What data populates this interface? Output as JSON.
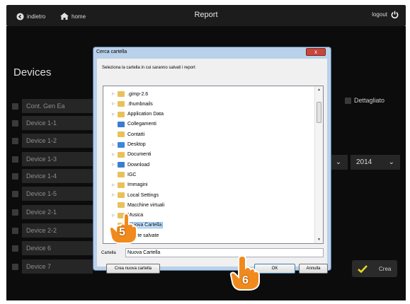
{
  "topbar": {
    "back_label": "indietro",
    "home_label": "home",
    "title": "Report",
    "logout_label": "logout"
  },
  "devices": {
    "title": "Devices",
    "items": [
      {
        "label": "Cont. Gen Ea"
      },
      {
        "label": "Device 1-1"
      },
      {
        "label": "Device 1-2"
      },
      {
        "label": "Device 1-3"
      },
      {
        "label": "Device 1-4"
      },
      {
        "label": "Device 1-5"
      },
      {
        "label": "Device 2-1"
      },
      {
        "label": "Device 2-2"
      },
      {
        "label": "Device 6"
      },
      {
        "label": "Device 7"
      }
    ]
  },
  "options": {
    "detailed_label": "Dettagliato",
    "year_value": "2014",
    "create_label": "Crea"
  },
  "dialog": {
    "title": "Cerca cartella",
    "close_label": "x",
    "instruction": "Seleziona la cartella in cui saranno salvati i report",
    "tree_items": [
      {
        "label": ".gimp-2.6",
        "expandable": true,
        "color": "#e8c15a"
      },
      {
        "label": ".thumbnails",
        "expandable": true,
        "color": "#e8c15a"
      },
      {
        "label": "Application Data",
        "expandable": true,
        "color": "#e8c15a"
      },
      {
        "label": "Collegamenti",
        "expandable": false,
        "color": "#3a7cd0"
      },
      {
        "label": "Contatti",
        "expandable": false,
        "color": "#e8c15a"
      },
      {
        "label": "Desktop",
        "expandable": true,
        "color": "#3a86d8"
      },
      {
        "label": "Documenti",
        "expandable": true,
        "color": "#e8c15a"
      },
      {
        "label": "Download",
        "expandable": true,
        "color": "#3a7cd0"
      },
      {
        "label": "IGC",
        "expandable": false,
        "color": "#e8c15a"
      },
      {
        "label": "Immagini",
        "expandable": true,
        "color": "#e8c15a"
      },
      {
        "label": "Local Settings",
        "expandable": true,
        "color": "#e8c15a"
      },
      {
        "label": "Macchine virtuali",
        "expandable": false,
        "color": "#e8c15a"
      },
      {
        "label": "Musica",
        "expandable": true,
        "color": "#e8c15a"
      },
      {
        "label": "Nuova Cartella",
        "expandable": false,
        "color": "#e8c15a",
        "selected": true
      },
      {
        "label": "Partite salvate",
        "expandable": false,
        "color": "#e8c15a"
      }
    ],
    "folder_label": "Cartella",
    "folder_value": "Nuova Cartella",
    "new_folder_label": "Crea nuova cartella",
    "ok_label": "OK",
    "cancel_label": "Annulla"
  },
  "callouts": {
    "step5": "5",
    "step6": "6",
    "color": "#f08a1c"
  },
  "colors": {
    "background": "#0c0c0c",
    "dialog_frame": "#b9d1ea",
    "accent_check": "#e3d62a"
  }
}
